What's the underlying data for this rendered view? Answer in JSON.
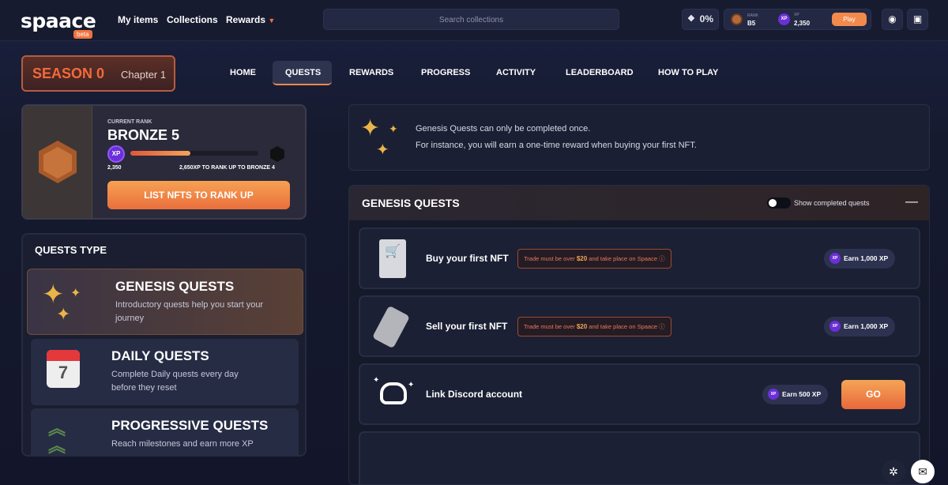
{
  "header": {
    "logo": "spaace",
    "logo_badge": "beta",
    "nav": [
      "My items",
      "Collections",
      "Rewards"
    ],
    "search_placeholder": "Search collections",
    "percent": "0%",
    "rank_label": "RANK",
    "rank_value": "B5",
    "xp_label": "XP",
    "xp_value": "2,350",
    "play_label": "Play"
  },
  "season": {
    "title": "SEASON 0",
    "chapter": "Chapter 1"
  },
  "tabs": [
    "HOME",
    "QUESTS",
    "REWARDS",
    "PROGRESS",
    "ACTIVITY",
    "LEADERBOARD",
    "HOW TO PLAY"
  ],
  "rank_card": {
    "current_label": "CURRENT RANK",
    "rank_name": "BRONZE 5",
    "xp_badge": "XP",
    "xp_current": "2,350",
    "xp_needed": "2,650XP TO RANK UP TO BRONZE 4",
    "progress_fraction": 0.47,
    "button": "LIST NFTS TO RANK UP"
  },
  "quest_types": {
    "title": "QUESTS TYPE",
    "items": [
      {
        "name": "GENESIS QUESTS",
        "desc": "Introductory quests help you start your journey"
      },
      {
        "name": "DAILY QUESTS",
        "desc": "Complete Daily quests every day before they reset",
        "calendar_number": "7"
      },
      {
        "name": "PROGRESSIVE QUESTS",
        "desc": "Reach milestones and earn more XP"
      }
    ]
  },
  "info": {
    "line1": "Genesis Quests can only be completed once.",
    "line2": "For instance, you will earn a one-time reward when buying your first NFT."
  },
  "genesis": {
    "title": "GENESIS QUESTS",
    "toggle_label": "Show completed quests",
    "collapse": "—",
    "quests": [
      {
        "name": "Buy your first NFT",
        "cond_a": "Trade must be over ",
        "cond_amount": "$20",
        "cond_b": " and take place on Spaace",
        "reward": "Earn 1,000 XP"
      },
      {
        "name": "Sell your first NFT",
        "cond_a": "Trade must be over ",
        "cond_amount": "$20",
        "cond_b": " and take place on Spaace",
        "reward": "Earn 1,000 XP"
      },
      {
        "name": "Link Discord account",
        "reward": "Earn 500 XP",
        "action": "GO"
      }
    ]
  },
  "colors": {
    "accent": "#f28a4c",
    "xp": "#6b2fd9",
    "bronze": "#b36a3a"
  }
}
